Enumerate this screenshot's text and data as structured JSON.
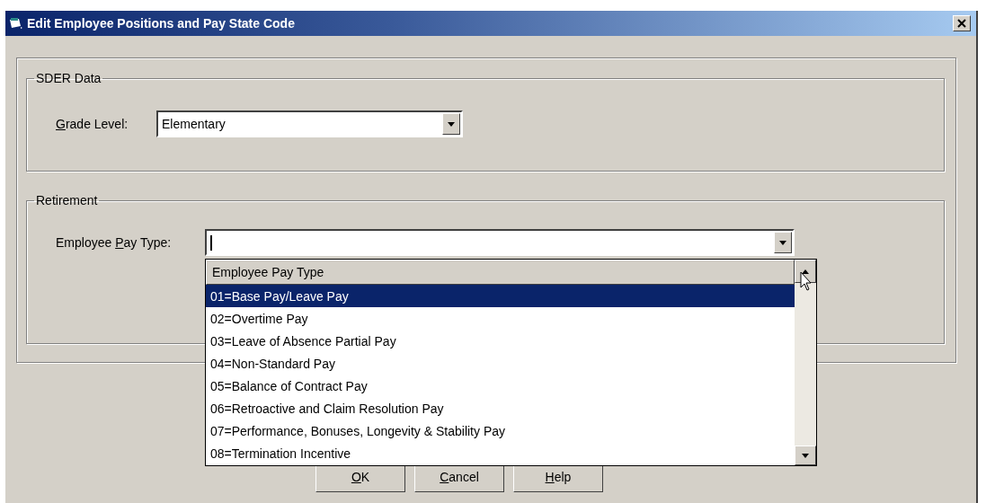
{
  "window": {
    "title": "Edit Employee Positions and Pay State Code"
  },
  "sder_group": {
    "title": "SDER Data",
    "grade_level": {
      "access_key": "G",
      "label_after": "rade Level:",
      "value": "Elementary"
    }
  },
  "retirement_group": {
    "title": "Retirement",
    "pay_type": {
      "label_before": "Employee ",
      "access_key": "P",
      "label_after": "ay Type:"
    }
  },
  "pay_type_list": {
    "header": "Employee Pay Type",
    "items": [
      {
        "label": "01=Base Pay/Leave Pay",
        "selected": true
      },
      {
        "label": "02=Overtime Pay",
        "selected": false
      },
      {
        "label": "03=Leave of Absence Partial Pay",
        "selected": false
      },
      {
        "label": "04=Non-Standard Pay",
        "selected": false
      },
      {
        "label": "05=Balance of Contract Pay",
        "selected": false
      },
      {
        "label": "06=Retroactive and Claim Resolution Pay",
        "selected": false
      },
      {
        "label": "07=Performance, Bonuses, Longevity & Stability Pay",
        "selected": false
      },
      {
        "label": "08=Termination Incentive",
        "selected": false
      }
    ]
  },
  "buttons": [
    {
      "access_key": "O",
      "label_after": "K"
    },
    {
      "access_key": "C",
      "label_after": "ancel"
    },
    {
      "access_key": "H",
      "label_after": "elp"
    }
  ]
}
